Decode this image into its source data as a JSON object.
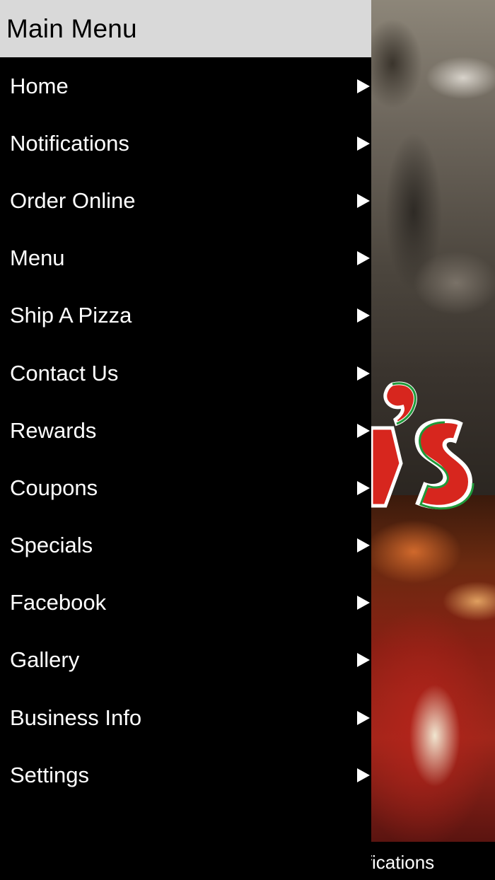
{
  "drawer": {
    "title": "Main Menu",
    "items": [
      {
        "label": "Home",
        "icon": "play-arrow-icon"
      },
      {
        "label": "Notifications",
        "icon": "play-arrow-icon"
      },
      {
        "label": "Order Online",
        "icon": "play-arrow-icon"
      },
      {
        "label": "Menu",
        "icon": "play-arrow-icon"
      },
      {
        "label": "Ship A Pizza",
        "icon": "play-arrow-icon"
      },
      {
        "label": "Contact Us",
        "icon": "play-arrow-icon"
      },
      {
        "label": "Rewards",
        "icon": "play-arrow-icon"
      },
      {
        "label": "Coupons",
        "icon": "play-arrow-icon"
      },
      {
        "label": "Specials",
        "icon": "play-arrow-icon"
      },
      {
        "label": "Facebook",
        "icon": "play-arrow-icon"
      },
      {
        "label": "Gallery",
        "icon": "play-arrow-icon"
      },
      {
        "label": "Business Info",
        "icon": "play-arrow-icon"
      },
      {
        "label": "Settings",
        "icon": "play-arrow-icon"
      }
    ]
  },
  "background": {
    "tab_label": "ifications"
  },
  "colors": {
    "header_bg": "#d9d9d9",
    "drawer_bg": "#000000",
    "text_light": "#ffffff",
    "logo_red": "#d7261e",
    "logo_green": "#1f9a3a"
  }
}
